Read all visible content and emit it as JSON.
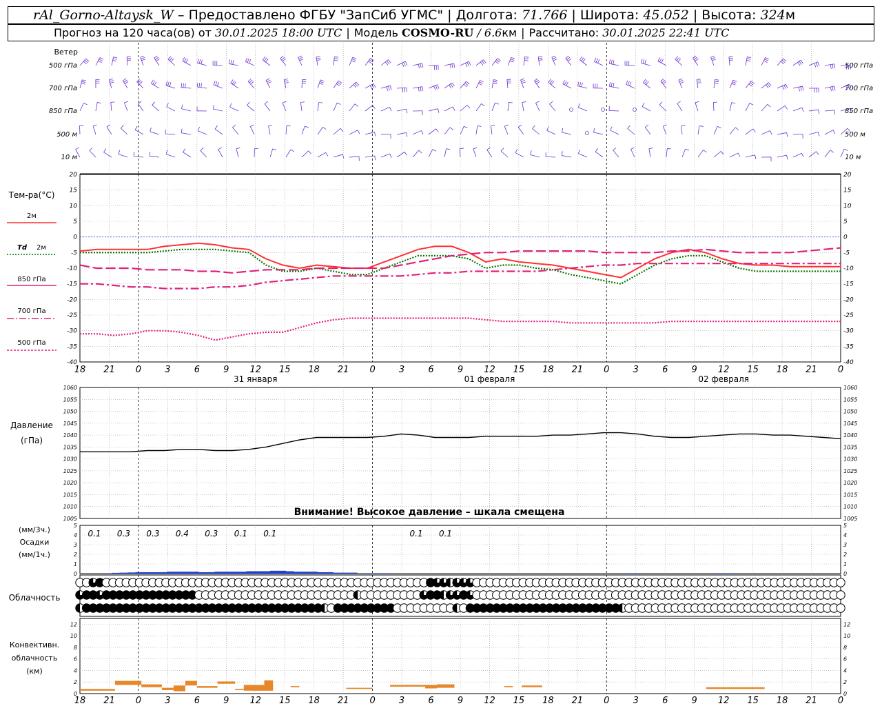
{
  "header": {
    "station": "rAl_Gorno-Altaysk_W",
    "dash": " – ",
    "provider": "Предоставлено ФГБУ \"ЗапСиб УГМС\"",
    "lon_label": "Долгота: ",
    "lon": "71.766",
    "lat_label": "Широта: ",
    "lat": "45.052",
    "alt_label": "Высота: ",
    "alt": "324",
    "alt_unit": "м",
    "forecast_label": "Прогноз на 120 часа(ов)  от ",
    "forecast_time": "30.01.2025 18:00 UTC",
    "model_label": "Модель ",
    "model_name": "COSMO-RU",
    "model_res": " / 6.6",
    "model_res_unit": "км",
    "calc_label": "Рассчитано: ",
    "calc_time": "30.01.2025 22:41 UTC"
  },
  "labels": {
    "wind": "Ветер",
    "temp": "Тем-ра(°С)",
    "temp_2m": "2м",
    "temp_td": "Td",
    "temp_td_2m": "2м",
    "temp_850": "850 гПа",
    "temp_700": "700 гПа",
    "temp_500": "500 гПа",
    "pressure_1": "Давление",
    "pressure_2": "(гПа)",
    "pressure_warning": "Внимание! Высокое давление – шкала смещена",
    "precip_1": "(мм/3ч.)",
    "precip_2": "Осадки",
    "precip_3": "(мм/1ч.)",
    "cloud": "Облачность",
    "conv_1": "Конвективн.",
    "conv_2": "облачность",
    "conv_3": "(км)"
  },
  "colors": {
    "temp_2m": "#ff3030",
    "td_2m": "#007700",
    "t850": "#e0207a",
    "t700": "#e0207a",
    "t500": "#e0207a",
    "wind": "#6a2ed0",
    "pressure": "#000000",
    "precip": "#2040d0",
    "convective": "#e8872a",
    "zero_line": "#3050ff"
  },
  "chart_data": {
    "time_axis": {
      "hour_labels": [
        "18",
        "21",
        "0",
        "3",
        "6",
        "9",
        "12",
        "15",
        "18",
        "21",
        "0",
        "3",
        "6",
        "9",
        "12",
        "15",
        "18",
        "21",
        "0",
        "3",
        "6",
        "9",
        "12",
        "15",
        "18",
        "21",
        "0"
      ],
      "day_labels": [
        {
          "text": "31 января",
          "at_index": 6
        },
        {
          "text": "01 февраля",
          "at_index": 14
        },
        {
          "text": "02 февраля",
          "at_index": 22
        }
      ]
    },
    "wind": {
      "levels": [
        "500 гПа",
        "700 гПа",
        "850 гПа",
        "500 м",
        "10  м"
      ]
    },
    "temperature": {
      "type": "line",
      "ylim": [
        -40,
        20
      ],
      "yticks": [
        20,
        15,
        10,
        5,
        0,
        -5,
        -10,
        -15,
        -20,
        -25,
        -30,
        -35,
        -40
      ],
      "series": [
        {
          "name": "2м",
          "key": "t2m",
          "style": "solid",
          "values": [
            -4.5,
            -4,
            -4,
            -4,
            -4,
            -3,
            -2.5,
            -2,
            -2.5,
            -3.5,
            -4,
            -7,
            -9,
            -10,
            -9,
            -9.5,
            -10,
            -10,
            -8,
            -6,
            -4,
            -3,
            -3,
            -5,
            -8,
            -7,
            -8,
            -8.5,
            -9,
            -10,
            -11,
            -12,
            -13,
            -10,
            -7,
            -5,
            -4,
            -5,
            -7,
            -8.5,
            -9,
            -9,
            -9.5,
            -9.5,
            -9.5,
            -9.5
          ]
        },
        {
          "name": "Td 2м",
          "key": "td2m",
          "style": "dotted",
          "values": [
            -5,
            -5,
            -5,
            -5,
            -5,
            -4.5,
            -4,
            -4,
            -4,
            -4.5,
            -5,
            -9,
            -11,
            -11,
            -10,
            -11,
            -12,
            -12,
            -10,
            -8,
            -6,
            -6,
            -6,
            -7,
            -10,
            -9,
            -9,
            -10,
            -10.5,
            -12,
            -13,
            -14,
            -15,
            -12,
            -9,
            -7,
            -6,
            -6,
            -8,
            -10,
            -11,
            -11,
            -11,
            -11,
            -11,
            -11
          ]
        },
        {
          "name": "850 гПа",
          "key": "t850",
          "style": "dashed",
          "values": [
            -9,
            -10,
            -10,
            -10,
            -10.5,
            -10.5,
            -10.5,
            -11,
            -11,
            -11.5,
            -11,
            -10.5,
            -10.5,
            -10.5,
            -10,
            -10,
            -10,
            -10,
            -10,
            -9,
            -8,
            -7,
            -6,
            -5.5,
            -5,
            -5,
            -4.5,
            -4.5,
            -4.5,
            -4.5,
            -4.5,
            -5,
            -5,
            -5,
            -5,
            -4.5,
            -4.5,
            -4,
            -4.5,
            -5,
            -5,
            -5,
            -5,
            -4.5,
            -4,
            -3.5
          ]
        },
        {
          "name": "700 гПа",
          "key": "t700",
          "style": "dashdot",
          "values": [
            -15,
            -15,
            -15.5,
            -16,
            -16,
            -16.5,
            -16.5,
            -16.5,
            -16,
            -16,
            -15.5,
            -14.5,
            -14,
            -13.5,
            -13,
            -12.5,
            -12.5,
            -12.5,
            -12.5,
            -12.5,
            -12,
            -11.5,
            -11.5,
            -11,
            -11,
            -11,
            -11,
            -11,
            -10.5,
            -10,
            -9.5,
            -9,
            -9,
            -8.5,
            -8.5,
            -8.5,
            -8.5,
            -8.5,
            -8.5,
            -8.5,
            -8.5,
            -8.5,
            -8.5,
            -8.5,
            -8.5,
            -8.5
          ]
        },
        {
          "name": "500 гПа",
          "key": "t500",
          "style": "dotted",
          "values": [
            -31,
            -31,
            -31.5,
            -31,
            -30,
            -30,
            -30.5,
            -31.5,
            -33,
            -32,
            -31,
            -30.5,
            -30.5,
            -29,
            -27.5,
            -26.5,
            -26,
            -26,
            -26,
            -26,
            -26,
            -26,
            -26,
            -26,
            -26.5,
            -27,
            -27,
            -27,
            -27,
            -27.5,
            -27.5,
            -27.5,
            -27.5,
            -27.5,
            -27.5,
            -27,
            -27,
            -27,
            -27,
            -27,
            -27,
            -27,
            -27,
            -27,
            -27,
            -27
          ]
        }
      ]
    },
    "pressure": {
      "type": "line",
      "ylim": [
        1005,
        1060
      ],
      "yticks": [
        1060,
        1055,
        1050,
        1045,
        1040,
        1035,
        1030,
        1025,
        1020,
        1015,
        1010,
        1005
      ],
      "values": [
        1033,
        1033,
        1033,
        1033,
        1033.5,
        1033.5,
        1034,
        1034,
        1033.5,
        1033.5,
        1034,
        1035,
        1036.5,
        1038,
        1039,
        1039,
        1039,
        1039,
        1039.5,
        1040.5,
        1040,
        1039,
        1039,
        1039,
        1039.5,
        1039.5,
        1039.5,
        1039.5,
        1040,
        1040,
        1040.5,
        1041,
        1041,
        1040.5,
        1039.5,
        1039,
        1039,
        1039.5,
        1040,
        1040.5,
        1040.5,
        1040,
        1040,
        1039.5,
        1039,
        1038.5
      ]
    },
    "precipitation": {
      "type": "bar",
      "ylim": [
        0,
        5
      ],
      "yticks": [
        5,
        4,
        3,
        2,
        1,
        0
      ],
      "labels_3h": [
        {
          "index": 0,
          "text": "0.1"
        },
        {
          "index": 1,
          "text": "0.3"
        },
        {
          "index": 2,
          "text": "0.3"
        },
        {
          "index": 3,
          "text": "0.4"
        },
        {
          "index": 4,
          "text": "0.3"
        },
        {
          "index": 5,
          "text": "0.1"
        },
        {
          "index": 6,
          "text": "0.1"
        },
        {
          "index": 11,
          "text": "0.1"
        },
        {
          "index": 12,
          "text": "0.1"
        }
      ],
      "hourly": [
        0,
        0,
        0,
        0.05,
        0.08,
        0.1,
        0.12,
        0.15,
        0.15,
        0.15,
        0.15,
        0.2,
        0.2,
        0.2,
        0.2,
        0.15,
        0.15,
        0.2,
        0.2,
        0.2,
        0.2,
        0.25,
        0.25,
        0.25,
        0.3,
        0.3,
        0.25,
        0.2,
        0.2,
        0.2,
        0.15,
        0.15,
        0.1,
        0.1,
        0.1,
        0,
        0.05,
        0.05,
        0.05,
        0,
        0,
        0,
        0,
        0,
        0,
        0,
        0,
        0,
        0,
        0,
        0,
        0,
        0,
        0,
        0,
        0,
        0,
        0,
        0,
        0,
        0,
        0,
        0,
        0,
        0,
        0,
        0,
        0,
        0,
        0.05,
        0.05,
        0,
        0,
        0,
        0,
        0,
        0,
        0,
        0,
        0,
        0.05,
        0.05,
        0.05,
        0,
        0,
        0,
        0,
        0,
        0,
        0,
        0,
        0,
        0,
        0
      ]
    },
    "cloudiness": {
      "rows": [
        [
          0,
          0,
          3,
          4,
          0,
          0,
          0,
          0,
          0,
          0,
          0,
          0,
          0,
          0,
          0,
          0,
          0,
          0,
          0,
          0,
          0,
          0,
          0,
          0,
          0,
          0,
          0,
          0,
          0,
          0,
          0,
          0,
          0,
          0,
          0,
          0,
          0,
          0,
          0,
          0,
          0,
          0,
          0,
          0,
          0,
          0,
          0,
          0,
          0,
          0,
          0,
          0,
          0,
          4,
          3,
          3,
          2,
          3,
          3,
          3,
          0,
          0,
          0,
          0,
          0,
          0,
          0,
          0,
          0,
          0,
          0,
          0,
          0,
          0,
          0,
          0,
          0,
          0,
          0,
          0,
          0,
          0,
          0,
          0,
          0,
          0,
          0,
          0,
          0,
          0,
          0,
          0,
          0,
          0,
          0,
          0,
          0,
          0,
          0,
          0,
          0,
          0,
          0,
          0,
          0,
          0,
          0,
          0,
          0,
          0,
          0,
          0,
          0,
          0,
          0,
          0
        ],
        [
          3,
          4,
          4,
          3,
          4,
          4,
          4,
          4,
          4,
          4,
          4,
          4,
          4,
          4,
          4,
          4,
          4,
          4,
          0,
          0,
          0,
          0,
          0,
          0,
          0,
          0,
          0,
          0,
          0,
          0,
          0,
          0,
          0,
          0,
          0,
          0,
          0,
          0,
          0,
          0,
          0,
          0,
          2,
          0,
          0,
          0,
          0,
          0,
          0,
          0,
          0,
          0,
          3,
          4,
          4,
          2,
          3,
          3,
          4,
          3,
          0,
          0,
          0,
          0,
          0,
          0,
          0,
          0,
          0,
          0,
          0,
          0,
          0,
          0,
          0,
          0,
          0,
          0,
          0,
          0,
          0,
          0,
          0,
          0,
          0,
          0,
          0,
          0,
          0,
          0,
          0,
          0,
          0,
          0,
          0,
          0,
          0,
          0,
          0,
          0,
          0,
          0,
          0,
          0,
          0,
          0,
          0,
          0,
          0,
          0,
          0,
          0,
          0,
          0,
          0,
          0
        ],
        [
          2,
          4,
          4,
          4,
          4,
          4,
          4,
          4,
          4,
          4,
          4,
          4,
          4,
          4,
          4,
          4,
          4,
          4,
          4,
          4,
          4,
          4,
          4,
          4,
          4,
          4,
          4,
          4,
          4,
          4,
          4,
          4,
          4,
          4,
          4,
          4,
          4,
          2,
          0,
          4,
          4,
          4,
          4,
          4,
          4,
          4,
          4,
          4,
          0,
          0,
          0,
          0,
          0,
          0,
          0,
          0,
          0,
          2,
          0,
          4,
          4,
          4,
          4,
          4,
          4,
          4,
          4,
          4,
          4,
          4,
          4,
          4,
          4,
          4,
          4,
          4,
          4,
          4,
          4,
          4,
          4,
          4,
          2,
          0,
          0,
          0,
          0,
          0,
          0,
          0,
          0,
          0,
          0,
          0,
          0,
          0,
          0,
          0,
          0,
          0,
          0,
          0,
          0,
          0,
          0,
          0,
          0,
          0,
          0,
          0,
          0,
          0,
          0,
          0,
          0,
          0
        ]
      ]
    },
    "convective": {
      "type": "bar",
      "ylim": [
        0,
        13
      ],
      "yticks": [
        12,
        10,
        8,
        6,
        4,
        2,
        0
      ],
      "segments": [
        {
          "from": 0,
          "to": 1.2,
          "base": 0.5,
          "top": 0.8
        },
        {
          "from": 1.2,
          "to": 2.1,
          "base": 1.5,
          "top": 2.2
        },
        {
          "from": 2.1,
          "to": 2.8,
          "base": 1.1,
          "top": 1.6
        },
        {
          "from": 2.8,
          "to": 3.2,
          "base": 0.6,
          "top": 1.0
        },
        {
          "from": 3.2,
          "to": 3.6,
          "base": 0.4,
          "top": 1.4
        },
        {
          "from": 3.6,
          "to": 4.0,
          "base": 1.4,
          "top": 2.2
        },
        {
          "from": 4.0,
          "to": 4.7,
          "base": 1.0,
          "top": 1.3
        },
        {
          "from": 4.7,
          "to": 5.3,
          "base": 1.7,
          "top": 2.1
        },
        {
          "from": 5.3,
          "to": 5.6,
          "base": 0.6,
          "top": 0.8
        },
        {
          "from": 5.6,
          "to": 6.3,
          "base": 0.5,
          "top": 1.5
        },
        {
          "from": 6.3,
          "to": 6.6,
          "base": 0.5,
          "top": 2.3
        },
        {
          "from": 7.2,
          "to": 7.5,
          "base": 1.1,
          "top": 1.3
        },
        {
          "from": 9.1,
          "to": 10.0,
          "base": 0.8,
          "top": 1.0
        },
        {
          "from": 10.6,
          "to": 11.8,
          "base": 1.2,
          "top": 1.5
        },
        {
          "from": 11.8,
          "to": 12.2,
          "base": 0.9,
          "top": 1.5
        },
        {
          "from": 12.2,
          "to": 12.8,
          "base": 1.0,
          "top": 1.6
        },
        {
          "from": 14.5,
          "to": 14.8,
          "base": 1.1,
          "top": 1.3
        },
        {
          "from": 15.1,
          "to": 15.8,
          "base": 1.1,
          "top": 1.4
        },
        {
          "from": 21.4,
          "to": 22.3,
          "base": 0.8,
          "top": 1.1
        },
        {
          "from": 22.3,
          "to": 23.4,
          "base": 0.8,
          "top": 1.1
        }
      ]
    }
  }
}
